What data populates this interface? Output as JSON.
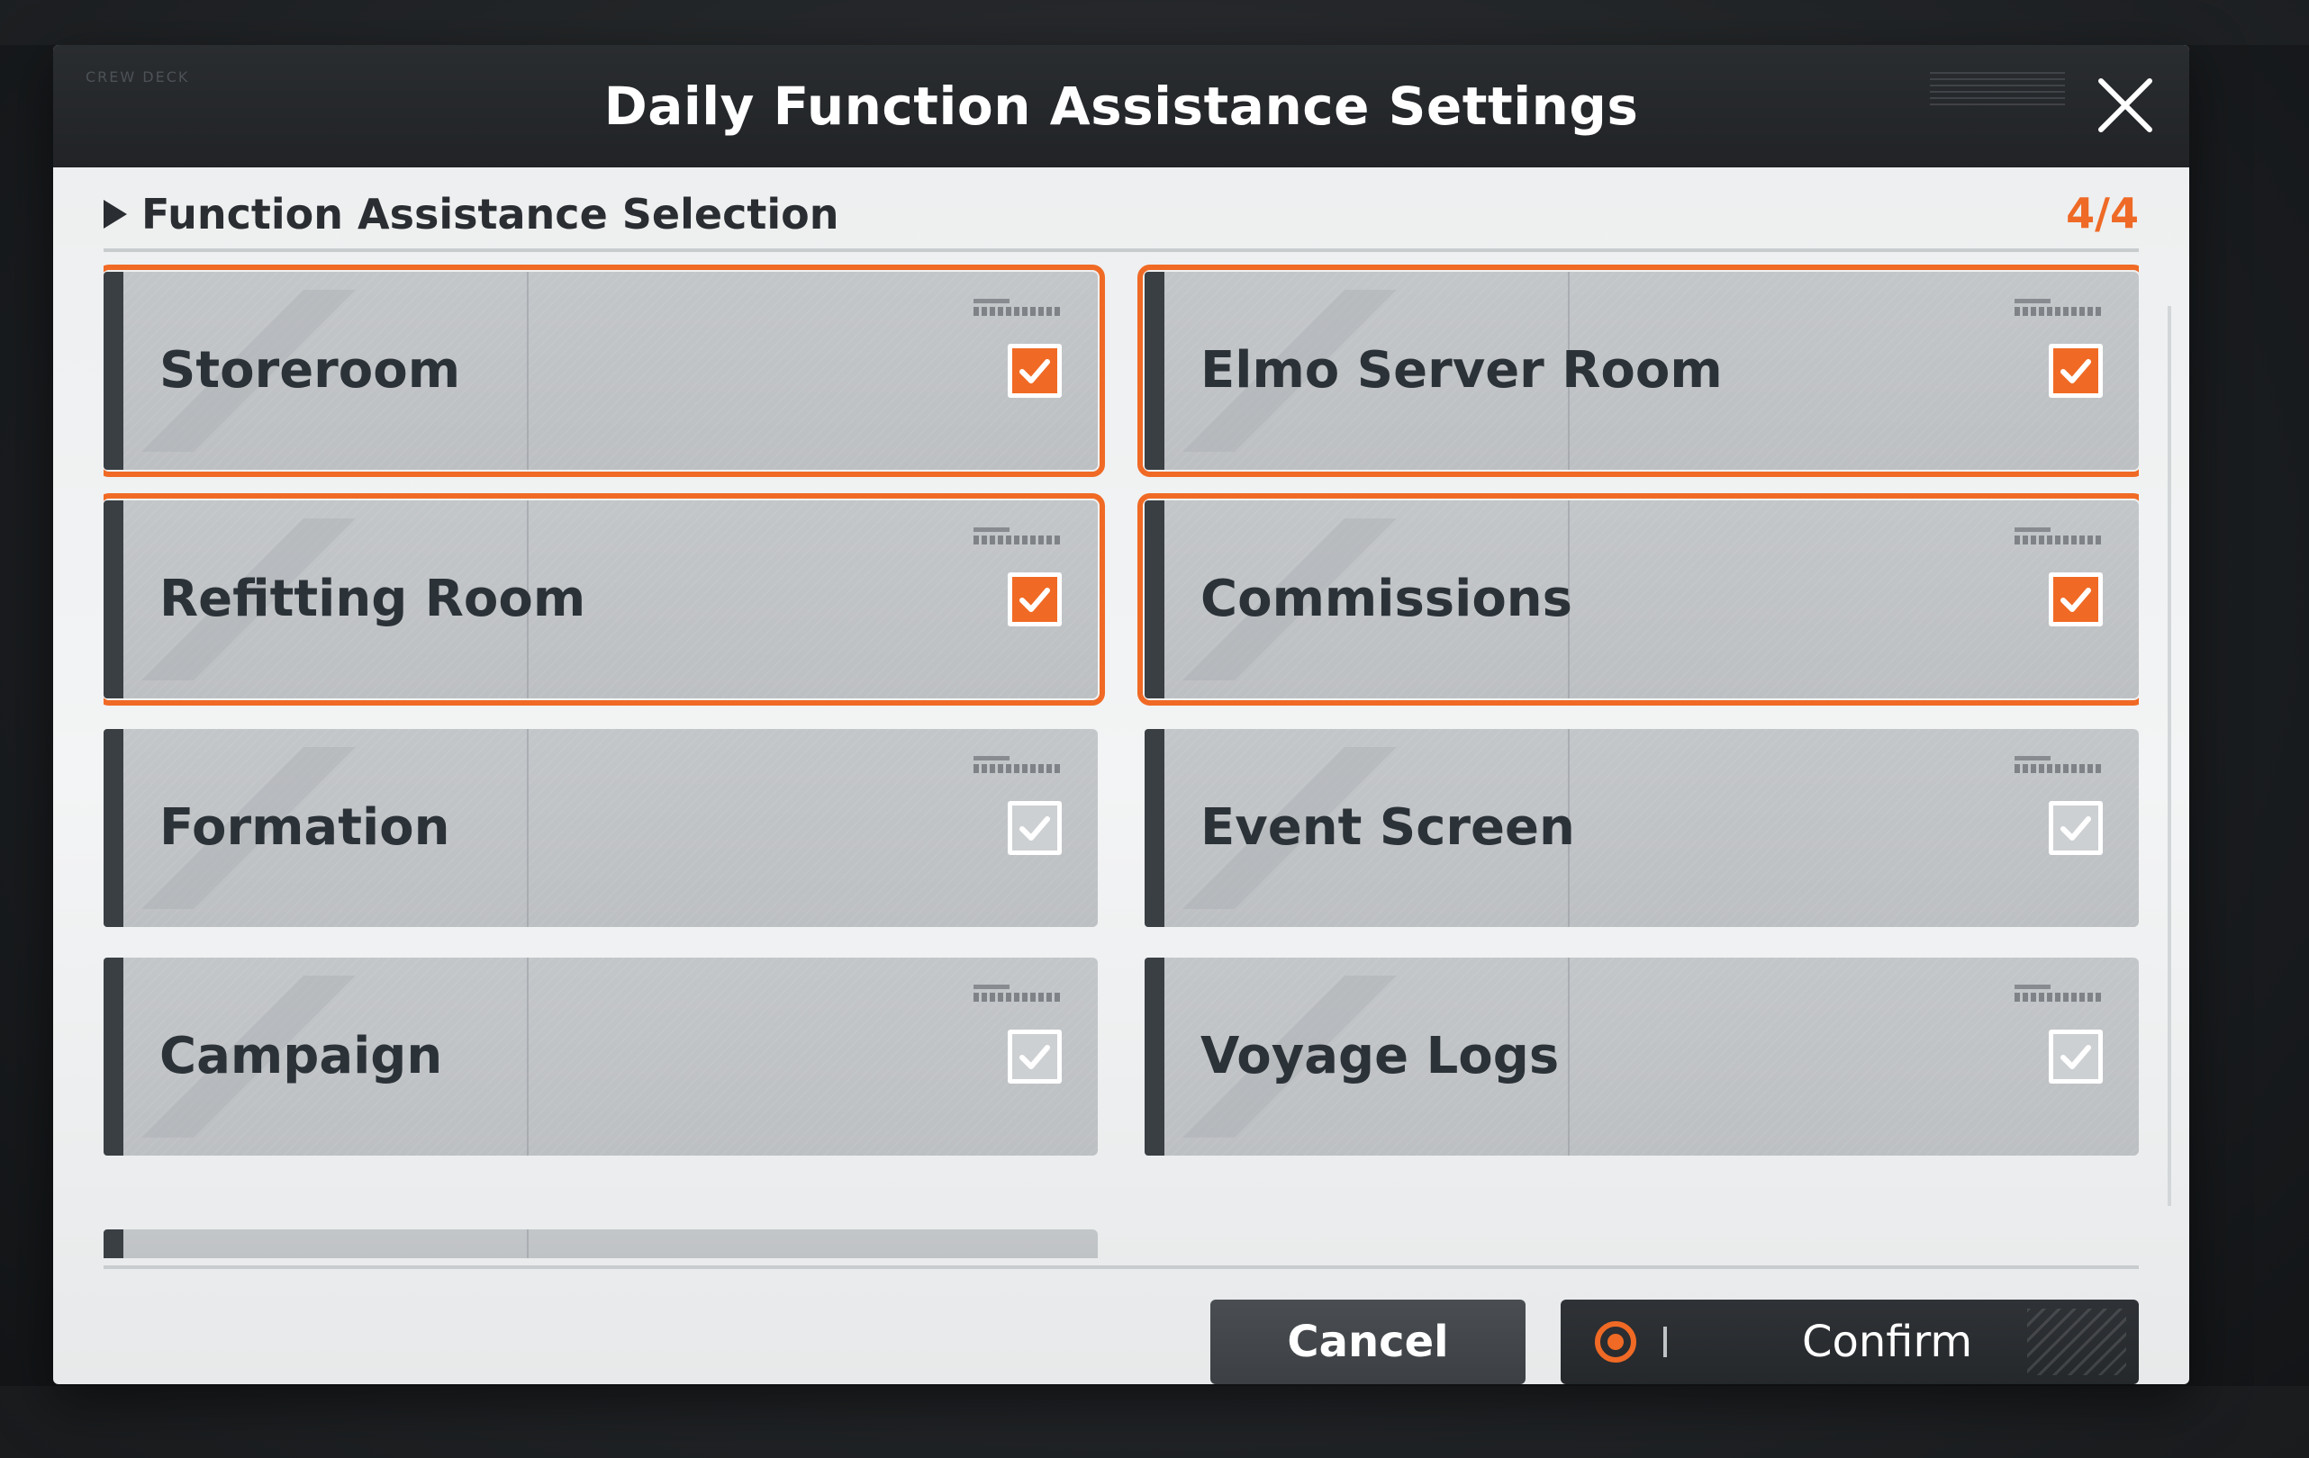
{
  "dialog": {
    "header_tag": "CREW DECK",
    "title": "Daily Function Assistance Settings",
    "close_icon": "close-icon"
  },
  "section": {
    "title": "Function Assistance Selection",
    "count": "4/4"
  },
  "options": [
    {
      "label": "Storeroom",
      "checked": true
    },
    {
      "label": "Elmo Server Room",
      "checked": true
    },
    {
      "label": "Refitting Room",
      "checked": true
    },
    {
      "label": "Commissions",
      "checked": true
    },
    {
      "label": "Formation",
      "checked": false
    },
    {
      "label": "Event Screen",
      "checked": false
    },
    {
      "label": "Campaign",
      "checked": false
    },
    {
      "label": "Voyage Logs",
      "checked": false
    }
  ],
  "buttons": {
    "cancel": "Cancel",
    "confirm": "Confirm"
  },
  "colors": {
    "accent": "#f06a25",
    "header_bg": "#222528",
    "card_bg": "#c0c3c6",
    "text_dark": "#2b3238"
  }
}
